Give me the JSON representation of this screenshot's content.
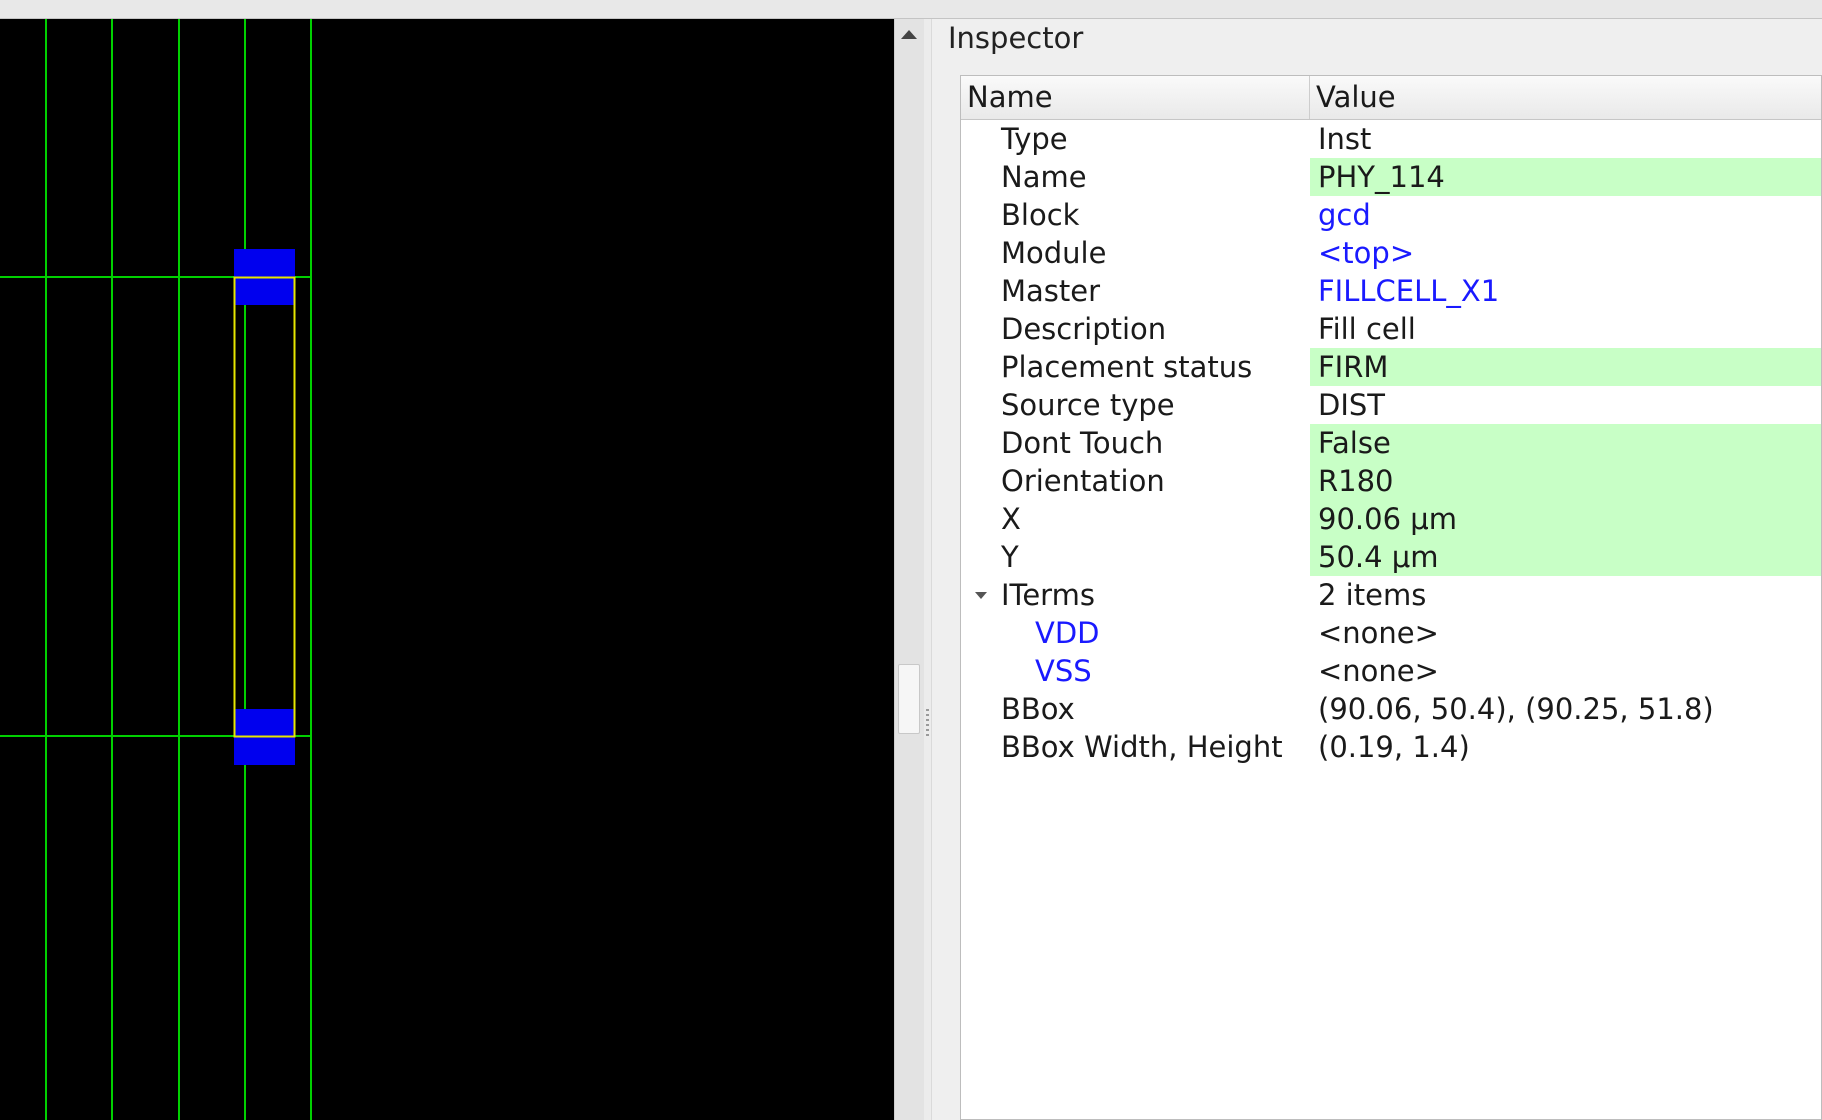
{
  "inspector": {
    "title": "Inspector",
    "columns": {
      "name": "Name",
      "value": "Value"
    },
    "rows": [
      {
        "name": "Type",
        "value": "Inst",
        "link": false,
        "editable": false,
        "level": 0
      },
      {
        "name": "Name",
        "value": "PHY_114",
        "link": false,
        "editable": true,
        "level": 0
      },
      {
        "name": "Block",
        "value": "gcd",
        "link": true,
        "editable": false,
        "level": 0
      },
      {
        "name": "Module",
        "value": "<top>",
        "link": true,
        "editable": false,
        "level": 0
      },
      {
        "name": "Master",
        "value": "FILLCELL_X1",
        "link": true,
        "editable": false,
        "level": 0
      },
      {
        "name": "Description",
        "value": "Fill cell",
        "link": false,
        "editable": false,
        "level": 0
      },
      {
        "name": "Placement status",
        "value": "FIRM",
        "link": false,
        "editable": true,
        "level": 0
      },
      {
        "name": "Source type",
        "value": "DIST",
        "link": false,
        "editable": false,
        "level": 0
      },
      {
        "name": "Dont Touch",
        "value": "False",
        "link": false,
        "editable": true,
        "level": 0
      },
      {
        "name": "Orientation",
        "value": "R180",
        "link": false,
        "editable": true,
        "level": 0
      },
      {
        "name": "X",
        "value": "90.06 μm",
        "link": false,
        "editable": true,
        "level": 0
      },
      {
        "name": "Y",
        "value": "50.4 μm",
        "link": false,
        "editable": true,
        "level": 0
      },
      {
        "name": "ITerms",
        "value": "2 items",
        "link": false,
        "editable": false,
        "level": 0,
        "expanded": true
      },
      {
        "name": "VDD",
        "value": "<none>",
        "link": false,
        "editable": false,
        "level": 1,
        "name_link": true
      },
      {
        "name": "VSS",
        "value": "<none>",
        "link": false,
        "editable": false,
        "level": 1,
        "name_link": true
      },
      {
        "name": "BBox",
        "value": "(90.06, 50.4), (90.25, 51.8)",
        "link": false,
        "editable": false,
        "level": 0
      },
      {
        "name": "BBox Width, Height",
        "value": "(0.19, 1.4)",
        "link": false,
        "editable": false,
        "level": 0
      }
    ]
  },
  "layout_view": {
    "background": "#000000",
    "grid_color": "#00d000",
    "highlight_color": "#e6e600",
    "pin_color": "#0000ee"
  },
  "colors": {
    "link": "#1a1aff",
    "editable_bg": "#c8ffc6"
  }
}
